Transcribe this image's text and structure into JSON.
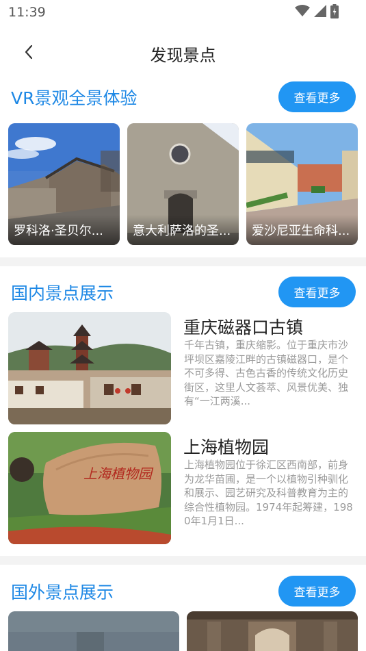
{
  "status": {
    "time": "11:39"
  },
  "nav": {
    "title": "发现景点"
  },
  "sections": {
    "vr": {
      "title": "VR景观全景体验",
      "more": "查看更多"
    },
    "domestic": {
      "title": "国内景点展示",
      "more": "查看更多"
    },
    "international": {
      "title": "国外景点展示",
      "more": "查看更多"
    }
  },
  "vr_items": [
    {
      "label": "罗科洛·圣贝尔..."
    },
    {
      "label": "意大利萨洛的圣..."
    },
    {
      "label": "爱沙尼亚生命科..."
    }
  ],
  "domestic_items": [
    {
      "name": "重庆磁器口古镇",
      "desc": "千年古镇，重庆缩影。位于重庆市沙坪坝区嘉陵江畔的古镇磁器口，是个不可多得、古色古香的传统文化历史街区，这里人文荟萃、风景优美、独有“一江两溪..."
    },
    {
      "name": "上海植物园",
      "desc": "上海植物园位于徐汇区西南部，前身为龙华苗圃，是一个以植物引种驯化和展示、园艺研究及科普教育为主的综合性植物园。1974年起筹建，1980年1月1日..."
    }
  ],
  "stone_text": "上海植物园",
  "colors": {
    "accent": "#2196f3",
    "section_title": "#1e88e5",
    "desc": "#9a9a9a"
  },
  "icons": [
    "wifi-icon",
    "cellular-signal-icon",
    "battery-charging-icon",
    "back-arrow-icon"
  ]
}
